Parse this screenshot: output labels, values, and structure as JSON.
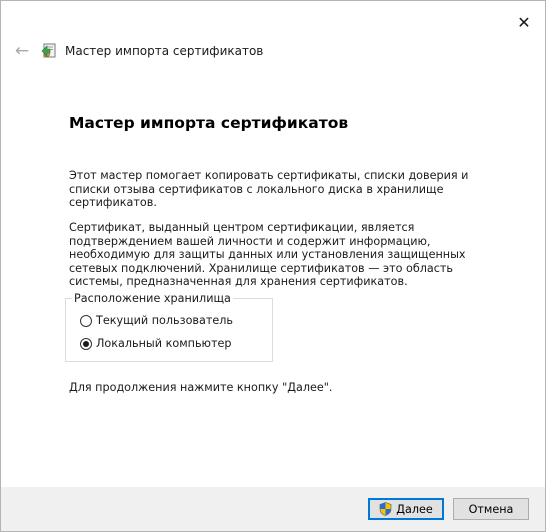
{
  "window": {
    "close_glyph": "✕",
    "back_glyph": "←"
  },
  "header": {
    "title": "Мастер импорта сертификатов",
    "icon": "certificate-wizard-icon"
  },
  "main": {
    "heading": "Мастер импорта сертификатов",
    "paragraph1": "Этот мастер помогает копировать сертификаты, списки доверия и списки отзыва сертификатов с локального диска в хранилище сертификатов.",
    "paragraph2": "Сертификат, выданный центром сертификации, является подтверждением вашей личности и содержит информацию, необходимую для защиты данных или установления защищенных сетевых подключений. Хранилище сертификатов — это область системы, предназначенная для хранения сертификатов.",
    "store_location": {
      "legend": "Расположение хранилища",
      "options": [
        {
          "label": "Текущий пользователь",
          "selected": false
        },
        {
          "label": "Локальный компьютер",
          "selected": true
        }
      ]
    },
    "continue_text": "Для продолжения нажмите кнопку \"Далее\"."
  },
  "footer": {
    "next_label": "Далее",
    "cancel_label": "Отмена",
    "accent_color": "#0078d7"
  }
}
